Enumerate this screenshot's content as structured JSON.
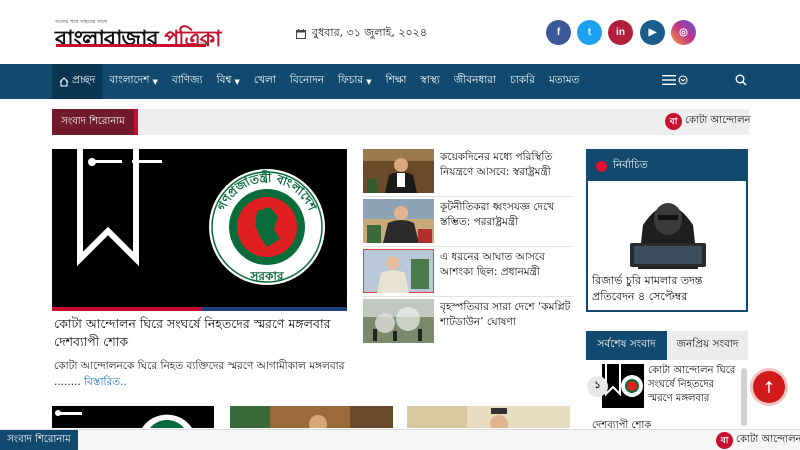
{
  "header": {
    "logo_tagline": "সত্যের পথে সাহসের সাথে",
    "logo_main": "বাংলাবাজার ",
    "logo_accent": "পত্রিকা",
    "logo_small": "অন্য",
    "date": "বুধবার, ৩১ জুলাই, ২০২৪",
    "social": [
      {
        "icon": "facebook-icon",
        "glyph": "f",
        "color": "#3b5998"
      },
      {
        "icon": "twitter-icon",
        "glyph": "t",
        "color": "#1da1f2"
      },
      {
        "icon": "linkedin-icon",
        "glyph": "in",
        "color": "#b0203a"
      },
      {
        "icon": "youtube-icon",
        "glyph": "▶",
        "color": "#1a5c8c"
      },
      {
        "icon": "instagram-icon",
        "glyph": "◎",
        "color": "#c13584"
      }
    ]
  },
  "nav": {
    "items": [
      {
        "label": "প্রচ্ছদ",
        "home": true
      },
      {
        "label": "বাংলাদেশ",
        "caret": true
      },
      {
        "label": "বাণিজ্য"
      },
      {
        "label": "বিশ্ব",
        "caret": true
      },
      {
        "label": "খেলা"
      },
      {
        "label": "বিনোদন"
      },
      {
        "label": "ফিচার",
        "caret": true
      },
      {
        "label": "শিক্ষা"
      },
      {
        "label": "স্বাস্থ্য"
      },
      {
        "label": "জীবনধারা"
      },
      {
        "label": "চাকরি"
      },
      {
        "label": "মতামত"
      }
    ]
  },
  "ticker": {
    "label": "সংবাদ শিরোনাম",
    "badge": "বা",
    "text": "কোটা আন্দোলন"
  },
  "lead": {
    "title": "কোটা আন্দোলন ঘিরে সংঘর্ষে নিহতদের স্মরণে মঙ্গলবার দেশব্যাপী শোক",
    "summary": "কোটা আন্দোলনকে ঘিরে নিহত ব্যক্তিদের স্মরণে আগামীকাল মঙ্গলবার ........ ",
    "more": "বিস্তারিত..",
    "seal_top": "গণপ্রজাতন্ত্রী বাংলাদেশ",
    "seal_bottom": "সরকার"
  },
  "middle": [
    {
      "title": "কয়েকদিনের মধ্যে পরিস্থিতি নিয়ন্ত্রণে আসবে: স্বরাষ্ট্রমন্ত্রী"
    },
    {
      "title": "কূটনীতিকরা ধ্বংসযজ্ঞ দেখে স্তম্ভিত: পররাষ্ট্রমন্ত্রী"
    },
    {
      "title": "এ ধরনের আঘাত আসবে আশংকা ছিল: প্রধানমন্ত্রী"
    },
    {
      "title": "বৃহস্পতিবার সারা দেশে ‘কমপ্লিট শাটডাউন’ ঘোষণা"
    }
  ],
  "right_card": {
    "label": "নির্বাচিত",
    "title": "রিজার্ভ চুরি মামলার তদন্ত প্রতিবেদন ৪ সেপ্টেম্বর"
  },
  "tabs": {
    "latest": "সর্বশেষ সংবাদ",
    "popular": "জনপ্রিয় সংবাদ",
    "item_number": "১",
    "item_title": "কোটা আন্দোলন ঘিরে সংঘর্ষে নিহতদের স্মরণে মঙ্গলবার",
    "item_title_cont": "দেশব্যাপী শোক"
  },
  "bottom_ticker": {
    "label": "সংবাদ শিরোনাম",
    "badge": "বা",
    "text": "কোটা আন্দোলন"
  },
  "colors": {
    "brand_navy": "#114a6e",
    "brand_red": "#c8102e",
    "ticker_maroon": "#711a2c",
    "link_blue": "#1769c0"
  }
}
